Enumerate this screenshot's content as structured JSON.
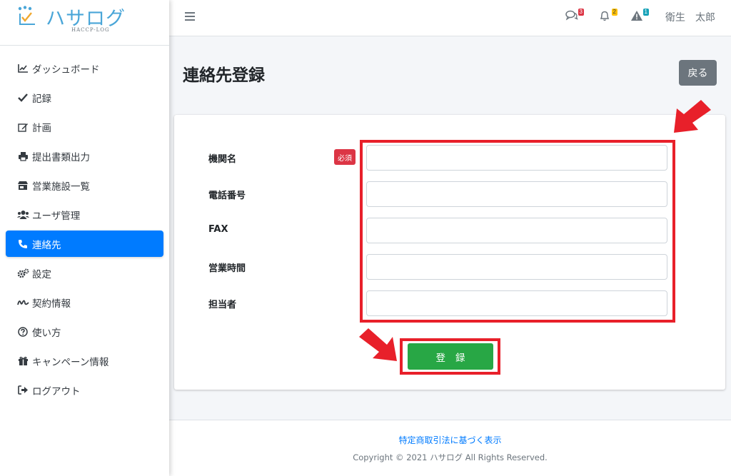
{
  "brand": {
    "name": "ハサログ",
    "sub": "HACCP-LOG"
  },
  "sidebar": {
    "items": [
      {
        "label": "ダッシュボード",
        "icon": "chart-line-icon"
      },
      {
        "label": "記録",
        "icon": "check-icon"
      },
      {
        "label": "計画",
        "icon": "edit-icon"
      },
      {
        "label": "提出書類出力",
        "icon": "print-icon"
      },
      {
        "label": "営業施設一覧",
        "icon": "store-icon"
      },
      {
        "label": "ユーザ管理",
        "icon": "users-icon"
      },
      {
        "label": "連絡先",
        "icon": "phone-icon",
        "active": true
      },
      {
        "label": "設定",
        "icon": "cogs-icon"
      },
      {
        "label": "契約情報",
        "icon": "signature-icon"
      },
      {
        "label": "使い方",
        "icon": "question-icon"
      },
      {
        "label": "キャンペーン情報",
        "icon": "gift-icon"
      },
      {
        "label": "ログアウト",
        "icon": "sign-out-icon"
      }
    ]
  },
  "header": {
    "messages_count": "3",
    "notifications_count": "2",
    "alerts_count": "1",
    "user_name": "衛生　太郎"
  },
  "main": {
    "title": "連絡先登録",
    "back_label": "戻る",
    "required_label": "必須",
    "fields": [
      {
        "label": "機関名",
        "value": ""
      },
      {
        "label": "電話番号",
        "value": ""
      },
      {
        "label": "FAX",
        "value": ""
      },
      {
        "label": "営業時間",
        "value": ""
      },
      {
        "label": "担当者",
        "value": ""
      }
    ],
    "submit_label": "登録"
  },
  "footer": {
    "link": "特定商取引法に基づく表示",
    "copyright": "Copyright © 2021 ハサログ All Rights Reserved."
  },
  "colors": {
    "primary": "#007bff",
    "success": "#28a745",
    "danger": "#dc3545",
    "highlight": "#e8202a",
    "secondary": "#6c757d",
    "brand": "#4aa6d8"
  }
}
